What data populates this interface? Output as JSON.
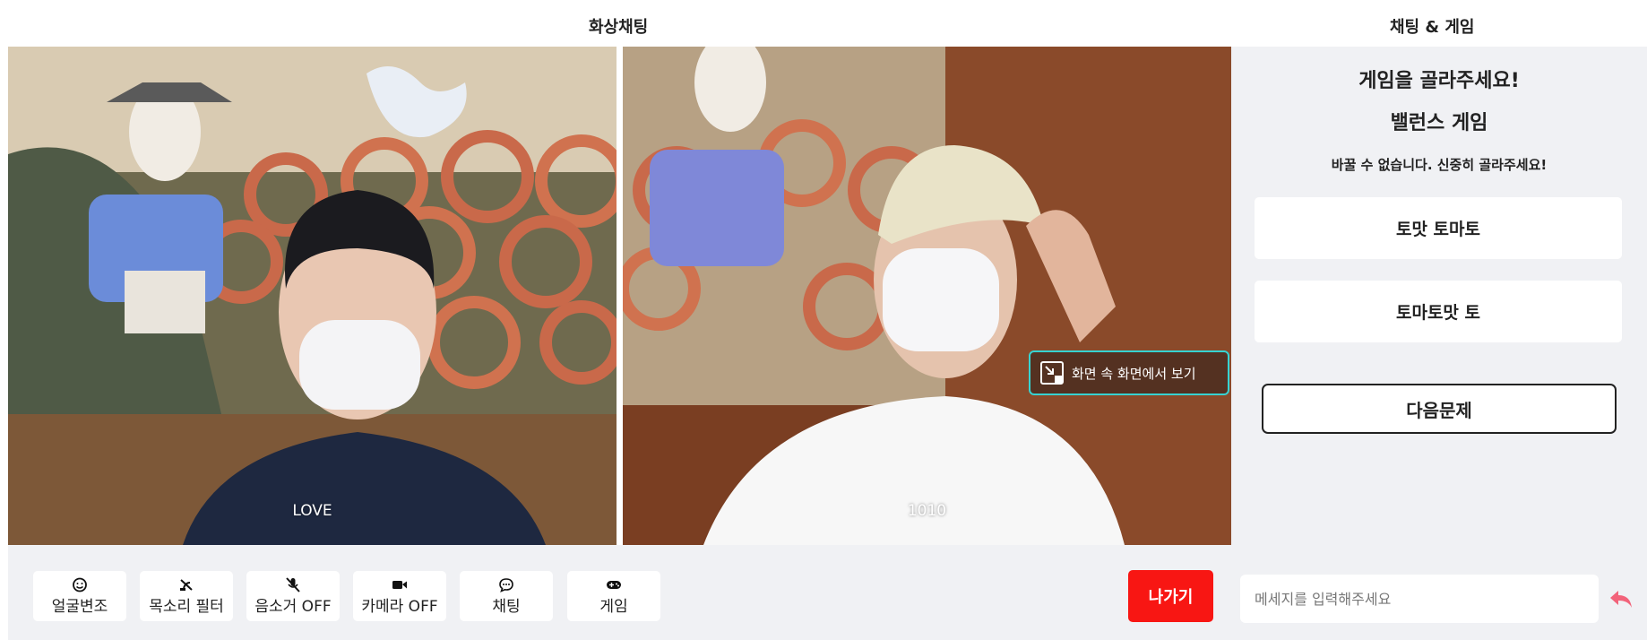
{
  "header": {
    "video_title": "화상채팅",
    "chat_title": "채팅 & 게임"
  },
  "videos": [
    {
      "name": "LOVE"
    },
    {
      "name": "1010"
    }
  ],
  "pip": {
    "label": "화면 속 화면에서 보기"
  },
  "game": {
    "prompt": "게임을 골라주세요!",
    "name": "밸런스 게임",
    "warning": "바꿀 수 없습니다. 신중히 골라주세요!",
    "choices": [
      "토맛 토마토",
      "토마토맛 토"
    ],
    "next_label": "다음문제"
  },
  "toolbar": {
    "buttons": [
      {
        "label": "얼굴변조",
        "icon": "smile-icon"
      },
      {
        "label": "목소리 필터",
        "icon": "voice-filter-icon"
      },
      {
        "label": "음소거 OFF",
        "icon": "mic-off-icon"
      },
      {
        "label": "카메라 OFF",
        "icon": "video-camera-icon"
      },
      {
        "label": "채팅",
        "icon": "chat-bubble-icon"
      },
      {
        "label": "게임",
        "icon": "gamepad-icon"
      }
    ],
    "exit_label": "나가기"
  },
  "chat": {
    "placeholder": "메세지를 입력해주세요",
    "send_icon": "reply-arrow-icon"
  },
  "colors": {
    "panel_bg": "#f0f1f4",
    "exit_red": "#f81613",
    "pip_border": "#36d3d2",
    "send_pink": "#f2637a"
  }
}
